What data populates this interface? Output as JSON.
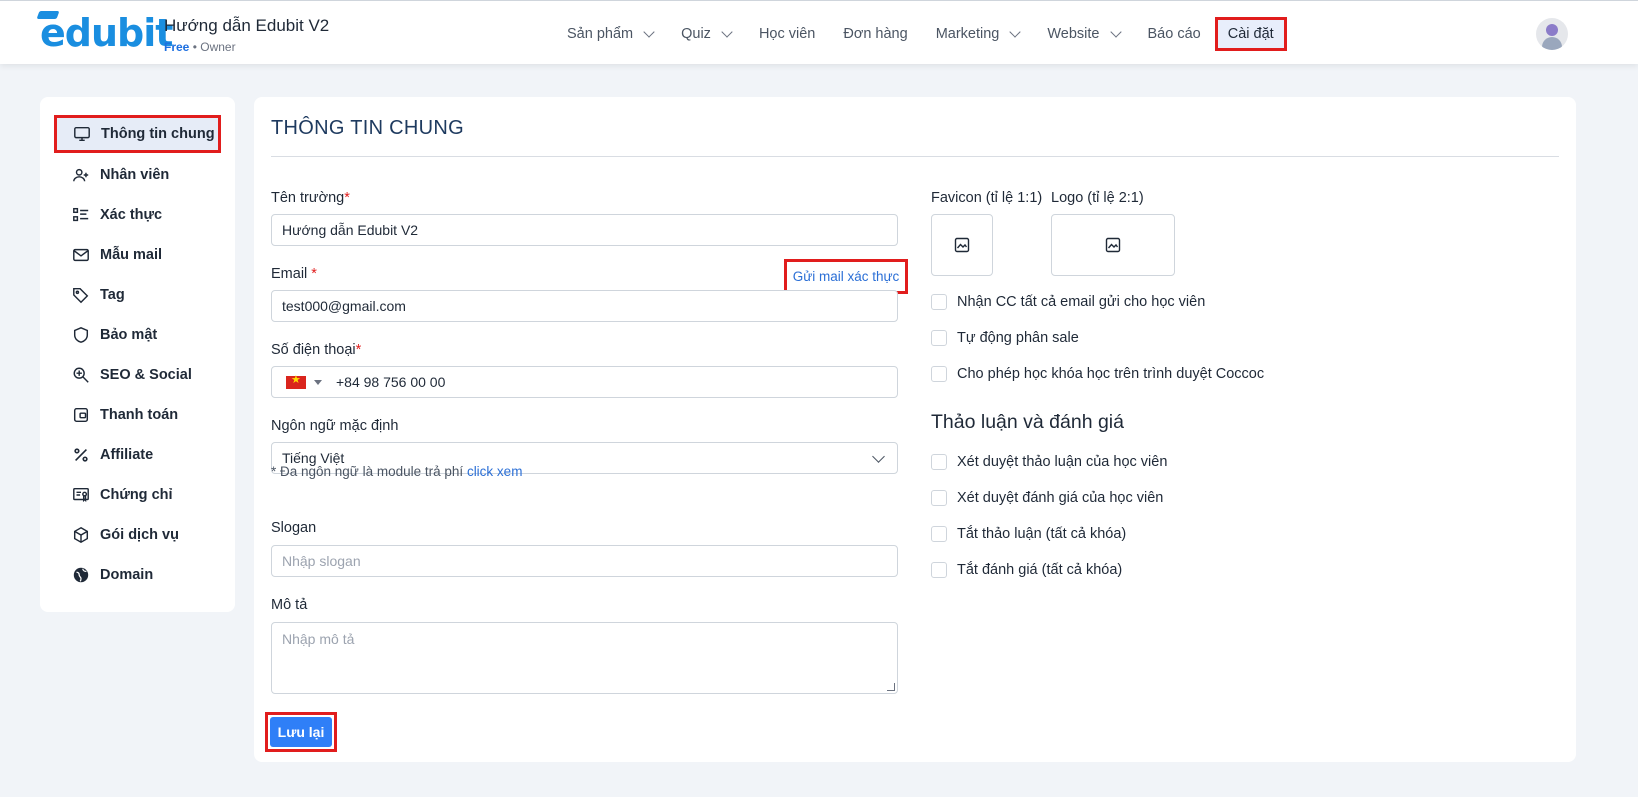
{
  "header": {
    "logo_text": "edubit",
    "site_title": "Hướng dẫn Edubit V2",
    "plan": "Free",
    "separator": " • ",
    "role": "Owner",
    "nav": [
      {
        "label": "Sản phẩm",
        "dropdown": true
      },
      {
        "label": "Quiz",
        "dropdown": true
      },
      {
        "label": "Học viên",
        "dropdown": false
      },
      {
        "label": "Đơn hàng",
        "dropdown": false
      },
      {
        "label": "Marketing",
        "dropdown": true
      },
      {
        "label": "Website",
        "dropdown": true
      },
      {
        "label": "Báo cáo",
        "dropdown": false
      },
      {
        "label": "Cài đặt",
        "dropdown": false,
        "active": true
      }
    ]
  },
  "sidebar": {
    "items": [
      {
        "label": "Thông tin chung",
        "icon": "monitor-icon",
        "active": true
      },
      {
        "label": "Nhân viên",
        "icon": "users-icon"
      },
      {
        "label": "Xác thực",
        "icon": "checklist-icon"
      },
      {
        "label": "Mẫu mail",
        "icon": "mail-icon"
      },
      {
        "label": "Tag",
        "icon": "tag-icon"
      },
      {
        "label": "Bảo mật",
        "icon": "shield-icon"
      },
      {
        "label": "SEO & Social",
        "icon": "seo-icon"
      },
      {
        "label": "Thanh toán",
        "icon": "wallet-icon"
      },
      {
        "label": "Affiliate",
        "icon": "percent-icon"
      },
      {
        "label": "Chứng chỉ",
        "icon": "certificate-icon"
      },
      {
        "label": "Gói dịch vụ",
        "icon": "package-icon"
      },
      {
        "label": "Domain",
        "icon": "globe-icon"
      }
    ]
  },
  "main": {
    "title": "THÔNG TIN CHUNG",
    "school_name": {
      "label": "Tên trường",
      "required": "*",
      "value": "Hướng dẫn Edubit V2"
    },
    "email": {
      "label": "Email",
      "required": "*",
      "value": "test000@gmail.com",
      "verify_link": "Gửi mail xác thực"
    },
    "phone": {
      "label": "Số điện thoại",
      "required": "*",
      "value": "+84 98 756 00 00",
      "country": "VN"
    },
    "language": {
      "label": "Ngôn ngữ mặc định",
      "value": "Tiếng Việt",
      "note": "* Đa ngôn ngữ là module trả phí",
      "note_link": "click xem"
    },
    "slogan": {
      "label": "Slogan",
      "placeholder": "Nhập slogan"
    },
    "description": {
      "label": "Mô tả",
      "placeholder": "Nhập mô tả"
    },
    "save_label": "Lưu lại",
    "favicon_label": "Favicon (tỉ lệ 1:1)",
    "logo_label": "Logo (tỉ lệ 2:1)",
    "options": [
      "Nhận CC tất cả email gửi cho học viên",
      "Tự động phân sale",
      "Cho phép học khóa học trên trình duyệt Coccoc"
    ],
    "discussion_title": "Thảo luận và đánh giá",
    "discussion_options": [
      "Xét duyệt thảo luận của học viên",
      "Xét duyệt đánh giá của học viên",
      "Tắt thảo luận (tất cả khóa)",
      "Tắt đánh giá (tất cả khóa)"
    ]
  },
  "colors": {
    "accent": "#2f7ff7",
    "highlight": "#e11d1d",
    "logo": "#1a8ee0"
  }
}
